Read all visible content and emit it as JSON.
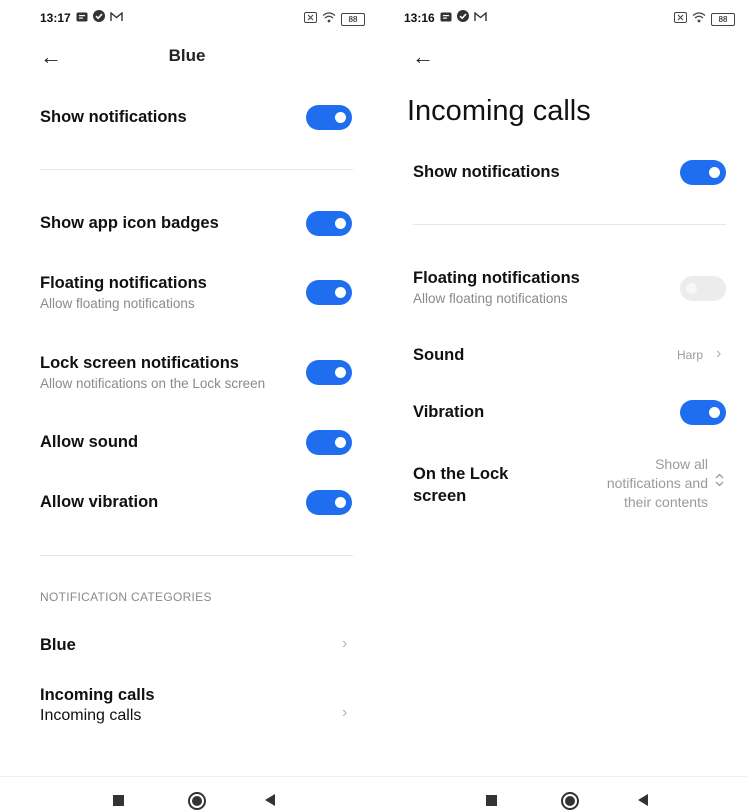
{
  "left": {
    "status": {
      "time": "13:17",
      "battery": "88"
    },
    "header": {
      "title": "Blue"
    },
    "show_notifications": {
      "label": "Show notifications",
      "on": true
    },
    "items": [
      {
        "label": "Show app icon badges",
        "subtitle": "",
        "on": true
      },
      {
        "label": "Floating notifications",
        "subtitle": "Allow floating notifications",
        "on": true
      },
      {
        "label": "Lock screen notifications",
        "subtitle": "Allow notifications on the Lock screen",
        "on": true
      },
      {
        "label": "Allow sound",
        "subtitle": "",
        "on": true
      },
      {
        "label": "Allow vibration",
        "subtitle": "",
        "on": true
      }
    ],
    "section_header": "NOTIFICATION CATEGORIES",
    "categories": [
      {
        "label": "Blue",
        "subtitle": ""
      },
      {
        "label": "Incoming calls",
        "subtitle": "Incoming calls"
      }
    ]
  },
  "right": {
    "status": {
      "time": "13:16",
      "battery": "88"
    },
    "page_title": "Incoming calls",
    "show_notifications": {
      "label": "Show notifications",
      "on": true
    },
    "floating": {
      "label": "Floating notifications",
      "subtitle": "Allow floating notifications",
      "on": false
    },
    "sound": {
      "label": "Sound",
      "value": "Harp"
    },
    "vibration": {
      "label": "Vibration",
      "on": true
    },
    "lock_screen": {
      "label_line1": "On the Lock",
      "label_line2": "screen",
      "value_line1": "Show all",
      "value_line2": "notifications and",
      "value_line3": "their contents"
    }
  },
  "colors": {
    "accent": "#1f6ef0",
    "toggle_off": "#ececec"
  }
}
